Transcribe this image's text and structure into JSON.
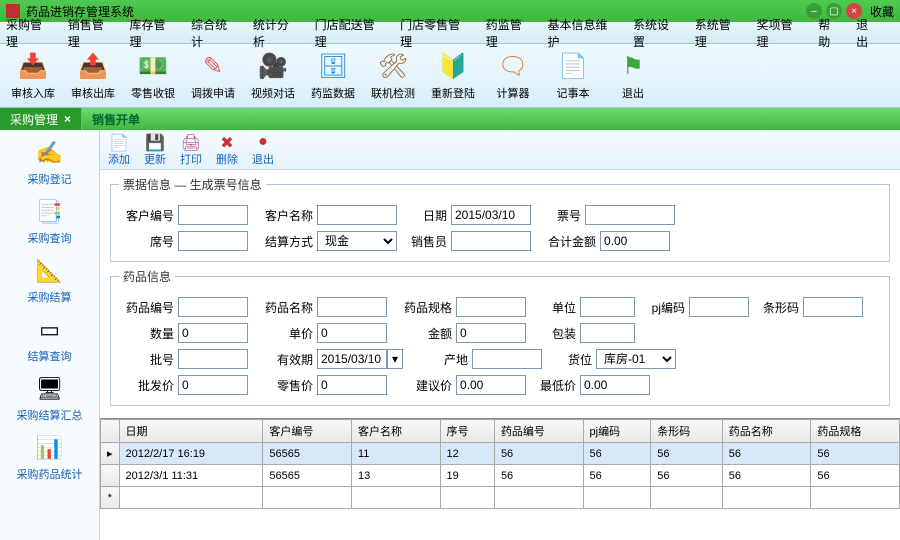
{
  "title": "药品进销存管理系统",
  "titlebar_right": "收藏",
  "menu": [
    "采购管理",
    "销售管理",
    "库存管理",
    "综合统计",
    "统计分析",
    "门店配送管理",
    "门店零售管理",
    "药监管理",
    "基本信息维护",
    "系统设置",
    "系统管理",
    "奖项管理",
    "帮助",
    "退出"
  ],
  "toolbar": [
    {
      "label": "审核入库",
      "icon": "📥",
      "color": "#2a8fd8"
    },
    {
      "label": "审核出库",
      "icon": "📤",
      "color": "#2a8fd8"
    },
    {
      "label": "零售收银",
      "icon": "💵",
      "color": "#e09020"
    },
    {
      "label": "调拨申请",
      "icon": "✎",
      "color": "#e06060"
    },
    {
      "label": "视频对话",
      "icon": "🎥",
      "color": "#3a9a3a"
    },
    {
      "label": "药监数据",
      "icon": "🗄",
      "color": "#2a8fd8"
    },
    {
      "label": "联机检测",
      "icon": "🛠",
      "color": "#a07040"
    },
    {
      "label": "重新登陆",
      "icon": "🔰",
      "color": "#2aa84a"
    },
    {
      "label": "计算器",
      "icon": "🗨",
      "color": "#e08030"
    },
    {
      "label": "记事本",
      "icon": "📄",
      "color": "#e0b030"
    },
    {
      "label": "退出",
      "icon": "⚑",
      "color": "#3aa83a"
    }
  ],
  "nav_tab": "采购管理",
  "panel_title": "销售开单",
  "sidebar": [
    {
      "label": "采购登记",
      "icon": "✍"
    },
    {
      "label": "采购查询",
      "icon": "📑"
    },
    {
      "label": "采购结算",
      "icon": "📐"
    },
    {
      "label": "结算查询",
      "icon": "▭"
    },
    {
      "label": "采购结算汇总",
      "icon": "🖥"
    },
    {
      "label": "采购药品统计",
      "icon": "📊"
    }
  ],
  "actions": [
    {
      "label": "添加",
      "icon": "📄",
      "color": "#2a8fd8"
    },
    {
      "label": "更新",
      "icon": "💾",
      "color": "#2a8fd8"
    },
    {
      "label": "打印",
      "icon": "🖨",
      "color": "#c05080"
    },
    {
      "label": "删除",
      "icon": "✖",
      "color": "#d03030"
    },
    {
      "label": "退出",
      "icon": "●",
      "color": "#d03030"
    }
  ],
  "legend1": "票据信息 — 生成票号信息",
  "legend2": "药品信息",
  "labels": {
    "customer_no": "客户编号",
    "customer_name": "客户名称",
    "date": "日期",
    "ticket": "票号",
    "seq": "席号",
    "settle": "结算方式",
    "sales": "销售员",
    "total": "合计金额",
    "drug_no": "药品编号",
    "drug_name": "药品名称",
    "spec": "药品规格",
    "unit": "单位",
    "pj": "pj编码",
    "barcode": "条形码",
    "qty": "数量",
    "price": "单价",
    "amount": "金额",
    "pack": "包装",
    "batch": "批号",
    "expiry": "有效期",
    "origin": "产地",
    "location": "货位",
    "wholesale": "批发价",
    "retail": "零售价",
    "suggest": "建议价",
    "lowest": "最低价"
  },
  "values": {
    "date": "2015/03/10",
    "settle": "现金",
    "total": "0.00",
    "qty": "0",
    "price": "0",
    "amount": "0",
    "expiry": "2015/03/10",
    "location": "库房-01",
    "wholesale": "0",
    "retail": "0",
    "suggest": "0.00",
    "lowest": "0.00"
  },
  "grid": {
    "columns": [
      "日期",
      "客户编号",
      "客户名称",
      "序号",
      "药品编号",
      "pj编码",
      "条形码",
      "药品名称",
      "药品规格"
    ],
    "rows": [
      [
        "2012/2/17 16:19",
        "56565",
        "11",
        "12",
        "56",
        "56",
        "56",
        "56",
        "56"
      ],
      [
        "2012/3/1 11:31",
        "56565",
        "13",
        "19",
        "56",
        "56",
        "56",
        "56",
        "56"
      ]
    ]
  }
}
